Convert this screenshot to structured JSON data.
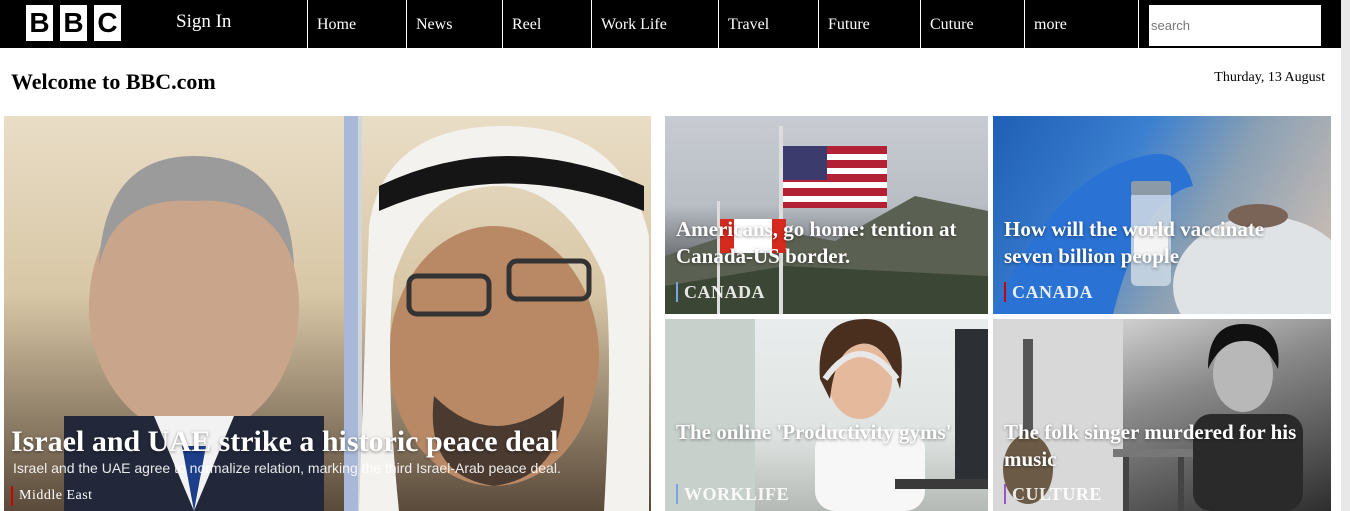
{
  "nav": {
    "logo_letters": [
      "B",
      "B",
      "C"
    ],
    "sign_in": "Sign In",
    "items": [
      "Home",
      "News",
      "Reel",
      "Work Life",
      "Travel",
      "Future",
      "Cuture",
      "more"
    ],
    "search_placeholder": "search"
  },
  "header": {
    "welcome": "Welcome to BBC.com",
    "date": "Thurday, 13 August"
  },
  "cards": {
    "main": {
      "title": "Israel and UAE strike a historic peace deal",
      "subtitle": "Israel and the UAE agree to normalize relation, marking the third Israel-Arab peace deal.",
      "tag": "Middle East"
    },
    "canada1": {
      "title": "Americans, go home: tention at Canada-US border.",
      "tag": "CANADA"
    },
    "vaccine": {
      "title": "How will the world vaccinate seven billion people",
      "tag": "CANADA"
    },
    "work": {
      "title": "The online 'Productivity gyms'",
      "tag": "WORKLIFE"
    },
    "culture": {
      "title": "The folk singer murdered for his music",
      "tag": "CULTURE"
    }
  },
  "colors": {
    "nav_bg": "#000000",
    "tag_accent": "#cc0000"
  }
}
